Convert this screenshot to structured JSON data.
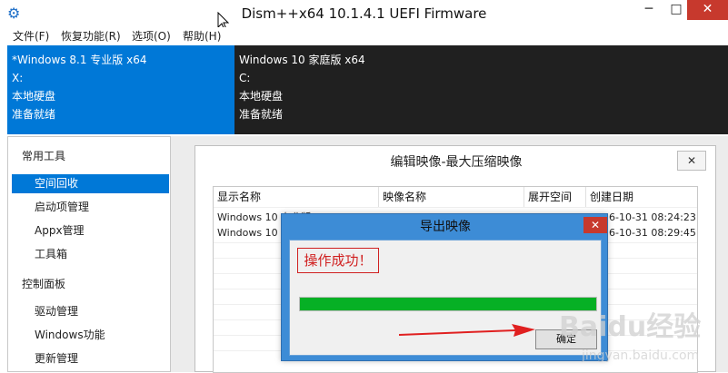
{
  "titlebar": {
    "title": "Dism++x64 10.1.4.1 UEFI Firmware",
    "icon": "gear-icon",
    "minimize_label": "─",
    "maximize_label": "□",
    "close_label": "✕"
  },
  "menu": {
    "items": [
      "文件(F)",
      "恢复功能(R)",
      "选项(O)",
      "帮助(H)"
    ]
  },
  "sessions": [
    {
      "lines": [
        "*Windows 8.1 专业版 x64",
        "X:",
        "本地硬盘",
        "准备就绪"
      ],
      "selected": true
    },
    {
      "lines": [
        "Windows 10 家庭版 x64",
        "C:",
        "本地硬盘",
        "准备就绪"
      ],
      "selected": false
    }
  ],
  "sidebar": {
    "group1": "常用工具",
    "items1": [
      "空间回收",
      "启动项管理",
      "Appx管理",
      "工具箱"
    ],
    "group2": "控制面板",
    "items2": [
      "驱动管理",
      "Windows功能",
      "更新管理"
    ]
  },
  "edit_dialog": {
    "title": "编辑映像-最大压缩映像",
    "close_label": "✕",
    "columns": [
      "显示名称",
      "映像名称",
      "展开空间",
      "创建日期"
    ],
    "rows": [
      [
        "Windows 10 专业版",
        "",
        "",
        "2016-10-31 08:24:23"
      ],
      [
        "Windows 10 家",
        "",
        "",
        "2016-10-31 08:29:45"
      ]
    ]
  },
  "export_dialog": {
    "title": "导出映像",
    "close_label": "✕",
    "message": "操作成功！",
    "progress": 1.0,
    "ok_label": "确定"
  },
  "watermark": {
    "text": "Baidu经验",
    "subtext": "jingyan.baidu.com"
  },
  "colors": {
    "accent": "#0078d7",
    "dialog_frame": "#3d8cd6",
    "progress": "#06b025",
    "alert_red": "#d02020"
  }
}
